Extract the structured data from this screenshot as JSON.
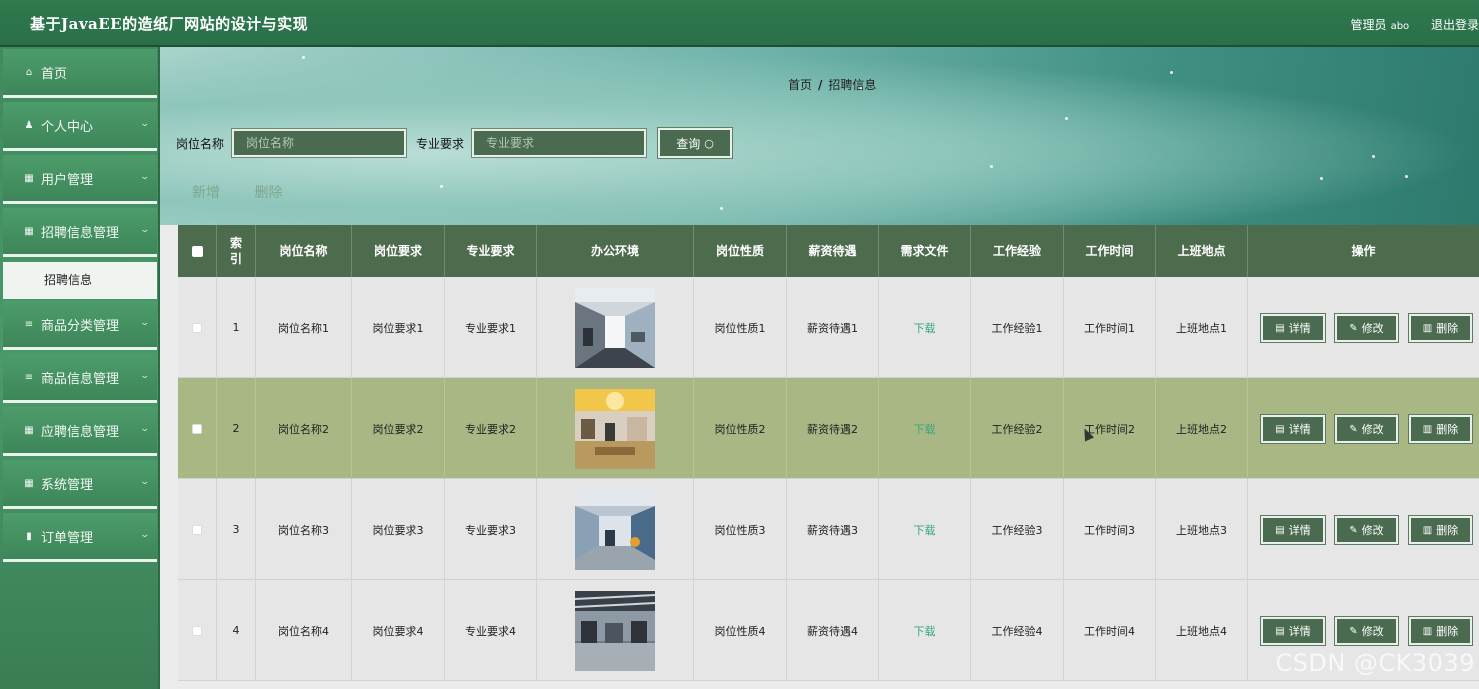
{
  "header": {
    "site_title": "基于JavaEE的造纸厂网站的设计与实现",
    "user_label": "管理员",
    "user_name": "abo",
    "logout": "退出登录"
  },
  "sidebar": {
    "items": [
      {
        "label": "首页",
        "icon": "home-icon",
        "glyph": "⌂",
        "chevron": false
      },
      {
        "label": "个人中心",
        "icon": "user-icon",
        "glyph": "♟",
        "chevron": true
      },
      {
        "label": "用户管理",
        "icon": "grid-icon",
        "glyph": "▦",
        "chevron": true
      },
      {
        "label": "招聘信息管理",
        "icon": "grid-icon",
        "glyph": "▦",
        "chevron": true
      },
      {
        "label": "商品分类管理",
        "icon": "list-icon",
        "glyph": "≡",
        "chevron": true
      },
      {
        "label": "商品信息管理",
        "icon": "list-icon",
        "glyph": "≡",
        "chevron": true
      },
      {
        "label": "应聘信息管理",
        "icon": "grid-icon",
        "glyph": "▦",
        "chevron": true
      },
      {
        "label": "系统管理",
        "icon": "grid-icon",
        "glyph": "▦",
        "chevron": true
      },
      {
        "label": "订单管理",
        "icon": "doc-icon",
        "glyph": "▮",
        "chevron": true
      }
    ],
    "active_sub": "招聘信息"
  },
  "breadcrumb": {
    "home": "首页",
    "sep": "/",
    "current": "招聘信息"
  },
  "search": {
    "field1_label": "岗位名称",
    "field1_placeholder": "岗位名称",
    "field2_label": "专业要求",
    "field2_placeholder": "专业要求",
    "query_btn": "查询",
    "query_icon": "search-icon"
  },
  "actions": {
    "add": "新增",
    "delete": "删除"
  },
  "table": {
    "headers": [
      "索引",
      "岗位名称",
      "岗位要求",
      "专业要求",
      "办公环境",
      "岗位性质",
      "薪资待遇",
      "需求文件",
      "工作经验",
      "工作时间",
      "上班地点",
      "操作"
    ],
    "index_header_l1": "索",
    "index_header_l2": "引",
    "rows": [
      {
        "idx": "1",
        "name": "岗位名称1",
        "req": "岗位要求1",
        "major": "专业要求1",
        "nature": "岗位性质1",
        "salary": "薪资待遇1",
        "file": "下载",
        "exp": "工作经验1",
        "time": "工作时间1",
        "place": "上班地点1"
      },
      {
        "idx": "2",
        "name": "岗位名称2",
        "req": "岗位要求2",
        "major": "专业要求2",
        "nature": "岗位性质2",
        "salary": "薪资待遇2",
        "file": "下载",
        "exp": "工作经验2",
        "time": "工作时间2",
        "place": "上班地点2"
      },
      {
        "idx": "3",
        "name": "岗位名称3",
        "req": "岗位要求3",
        "major": "专业要求3",
        "nature": "岗位性质3",
        "salary": "薪资待遇3",
        "file": "下载",
        "exp": "工作经验3",
        "time": "工作时间3",
        "place": "上班地点3"
      },
      {
        "idx": "4",
        "name": "岗位名称4",
        "req": "岗位要求4",
        "major": "专业要求4",
        "nature": "岗位性质4",
        "salary": "薪资待遇4",
        "file": "下载",
        "exp": "工作经验4",
        "time": "工作时间4",
        "place": "上班地点4"
      }
    ],
    "row_buttons": {
      "detail": "详情",
      "edit": "修改",
      "delete": "删除"
    }
  },
  "watermark": "CSDN @CK3039",
  "colors": {
    "primary": "#2f7a4f",
    "button": "#4b6b50",
    "table_header": "#4d6c4e",
    "highlight_row": "#a9b784",
    "download": "#3aa87a"
  }
}
